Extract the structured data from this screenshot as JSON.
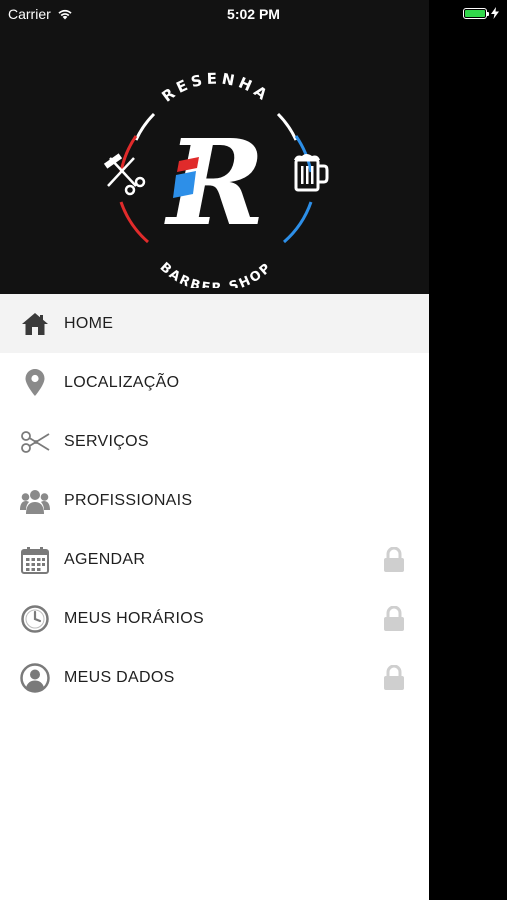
{
  "status_bar": {
    "carrier": "Carrier",
    "time": "5:02 PM",
    "battery_percent": 100
  },
  "drawer": {
    "logo": {
      "top_text": "RESENHA",
      "bottom_text": "BARBER SHOP",
      "letter": "R",
      "colors": {
        "red": "#e02b2b",
        "blue": "#2d8fe8",
        "white": "#ffffff"
      }
    },
    "menu": [
      {
        "label": "HOME",
        "icon": "home-icon",
        "active": true,
        "locked": false
      },
      {
        "label": "LOCALIZAÇÃO",
        "icon": "location-pin-icon",
        "active": false,
        "locked": false
      },
      {
        "label": "SERVIÇOS",
        "icon": "scissors-icon",
        "active": false,
        "locked": false
      },
      {
        "label": "PROFISSIONAIS",
        "icon": "people-icon",
        "active": false,
        "locked": false
      },
      {
        "label": "AGENDAR",
        "icon": "calendar-icon",
        "active": false,
        "locked": true
      },
      {
        "label": "MEUS HORÁRIOS",
        "icon": "clock-icon",
        "active": false,
        "locked": true
      },
      {
        "label": "MEUS DADOS",
        "icon": "user-icon",
        "active": false,
        "locked": true
      }
    ]
  }
}
